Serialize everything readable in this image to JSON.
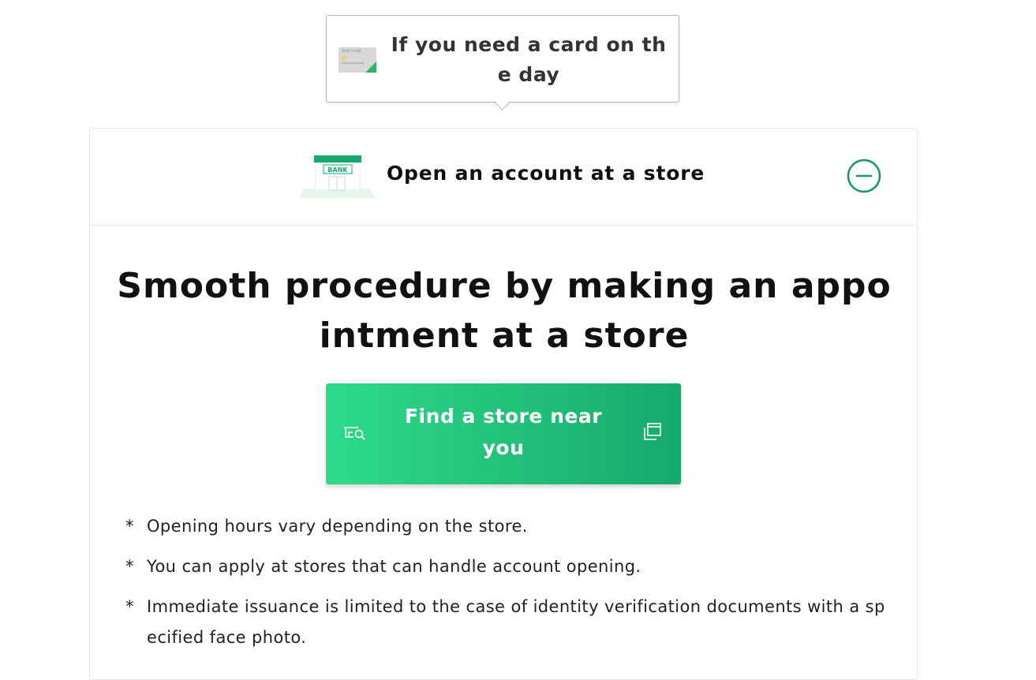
{
  "tooltip": {
    "text": "If you need a card on the day",
    "card_icon": "debit-card-icon",
    "card_label": "DEBIT CARD"
  },
  "accordion": {
    "title": "Open an account at a store",
    "bank_icon": "bank-building-icon",
    "bank_sign": "BANK",
    "toggle_icon": "minus-circle-icon",
    "accent_color": "#17966a"
  },
  "content": {
    "headline": "Smooth procedure by making an appointment at a store",
    "cta": {
      "label": "Find a store near you",
      "left_icon": "store-search-icon",
      "right_icon": "external-window-icon",
      "gradient_start": "#2edb8a",
      "gradient_end": "#17a96c"
    },
    "notes": [
      {
        "mark": "*",
        "text": "Opening hours vary depending on the store."
      },
      {
        "mark": "*",
        "text": "You can apply at stores that can handle account opening."
      },
      {
        "mark": "*",
        "text": "Immediate issuance is limited to the case of identity verification documents with a specified face photo."
      }
    ]
  }
}
